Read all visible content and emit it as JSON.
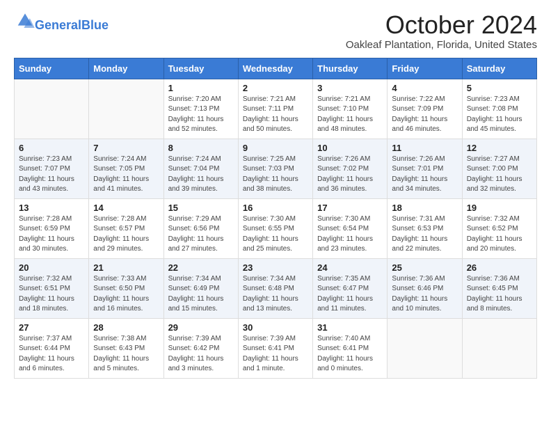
{
  "header": {
    "logo_general": "General",
    "logo_blue": "Blue",
    "month_title": "October 2024",
    "location": "Oakleaf Plantation, Florida, United States"
  },
  "days_of_week": [
    "Sunday",
    "Monday",
    "Tuesday",
    "Wednesday",
    "Thursday",
    "Friday",
    "Saturday"
  ],
  "weeks": [
    [
      {
        "day": "",
        "sunrise": "",
        "sunset": "",
        "daylight": ""
      },
      {
        "day": "",
        "sunrise": "",
        "sunset": "",
        "daylight": ""
      },
      {
        "day": "1",
        "sunrise": "Sunrise: 7:20 AM",
        "sunset": "Sunset: 7:13 PM",
        "daylight": "Daylight: 11 hours and 52 minutes."
      },
      {
        "day": "2",
        "sunrise": "Sunrise: 7:21 AM",
        "sunset": "Sunset: 7:11 PM",
        "daylight": "Daylight: 11 hours and 50 minutes."
      },
      {
        "day": "3",
        "sunrise": "Sunrise: 7:21 AM",
        "sunset": "Sunset: 7:10 PM",
        "daylight": "Daylight: 11 hours and 48 minutes."
      },
      {
        "day": "4",
        "sunrise": "Sunrise: 7:22 AM",
        "sunset": "Sunset: 7:09 PM",
        "daylight": "Daylight: 11 hours and 46 minutes."
      },
      {
        "day": "5",
        "sunrise": "Sunrise: 7:23 AM",
        "sunset": "Sunset: 7:08 PM",
        "daylight": "Daylight: 11 hours and 45 minutes."
      }
    ],
    [
      {
        "day": "6",
        "sunrise": "Sunrise: 7:23 AM",
        "sunset": "Sunset: 7:07 PM",
        "daylight": "Daylight: 11 hours and 43 minutes."
      },
      {
        "day": "7",
        "sunrise": "Sunrise: 7:24 AM",
        "sunset": "Sunset: 7:05 PM",
        "daylight": "Daylight: 11 hours and 41 minutes."
      },
      {
        "day": "8",
        "sunrise": "Sunrise: 7:24 AM",
        "sunset": "Sunset: 7:04 PM",
        "daylight": "Daylight: 11 hours and 39 minutes."
      },
      {
        "day": "9",
        "sunrise": "Sunrise: 7:25 AM",
        "sunset": "Sunset: 7:03 PM",
        "daylight": "Daylight: 11 hours and 38 minutes."
      },
      {
        "day": "10",
        "sunrise": "Sunrise: 7:26 AM",
        "sunset": "Sunset: 7:02 PM",
        "daylight": "Daylight: 11 hours and 36 minutes."
      },
      {
        "day": "11",
        "sunrise": "Sunrise: 7:26 AM",
        "sunset": "Sunset: 7:01 PM",
        "daylight": "Daylight: 11 hours and 34 minutes."
      },
      {
        "day": "12",
        "sunrise": "Sunrise: 7:27 AM",
        "sunset": "Sunset: 7:00 PM",
        "daylight": "Daylight: 11 hours and 32 minutes."
      }
    ],
    [
      {
        "day": "13",
        "sunrise": "Sunrise: 7:28 AM",
        "sunset": "Sunset: 6:59 PM",
        "daylight": "Daylight: 11 hours and 30 minutes."
      },
      {
        "day": "14",
        "sunrise": "Sunrise: 7:28 AM",
        "sunset": "Sunset: 6:57 PM",
        "daylight": "Daylight: 11 hours and 29 minutes."
      },
      {
        "day": "15",
        "sunrise": "Sunrise: 7:29 AM",
        "sunset": "Sunset: 6:56 PM",
        "daylight": "Daylight: 11 hours and 27 minutes."
      },
      {
        "day": "16",
        "sunrise": "Sunrise: 7:30 AM",
        "sunset": "Sunset: 6:55 PM",
        "daylight": "Daylight: 11 hours and 25 minutes."
      },
      {
        "day": "17",
        "sunrise": "Sunrise: 7:30 AM",
        "sunset": "Sunset: 6:54 PM",
        "daylight": "Daylight: 11 hours and 23 minutes."
      },
      {
        "day": "18",
        "sunrise": "Sunrise: 7:31 AM",
        "sunset": "Sunset: 6:53 PM",
        "daylight": "Daylight: 11 hours and 22 minutes."
      },
      {
        "day": "19",
        "sunrise": "Sunrise: 7:32 AM",
        "sunset": "Sunset: 6:52 PM",
        "daylight": "Daylight: 11 hours and 20 minutes."
      }
    ],
    [
      {
        "day": "20",
        "sunrise": "Sunrise: 7:32 AM",
        "sunset": "Sunset: 6:51 PM",
        "daylight": "Daylight: 11 hours and 18 minutes."
      },
      {
        "day": "21",
        "sunrise": "Sunrise: 7:33 AM",
        "sunset": "Sunset: 6:50 PM",
        "daylight": "Daylight: 11 hours and 16 minutes."
      },
      {
        "day": "22",
        "sunrise": "Sunrise: 7:34 AM",
        "sunset": "Sunset: 6:49 PM",
        "daylight": "Daylight: 11 hours and 15 minutes."
      },
      {
        "day": "23",
        "sunrise": "Sunrise: 7:34 AM",
        "sunset": "Sunset: 6:48 PM",
        "daylight": "Daylight: 11 hours and 13 minutes."
      },
      {
        "day": "24",
        "sunrise": "Sunrise: 7:35 AM",
        "sunset": "Sunset: 6:47 PM",
        "daylight": "Daylight: 11 hours and 11 minutes."
      },
      {
        "day": "25",
        "sunrise": "Sunrise: 7:36 AM",
        "sunset": "Sunset: 6:46 PM",
        "daylight": "Daylight: 11 hours and 10 minutes."
      },
      {
        "day": "26",
        "sunrise": "Sunrise: 7:36 AM",
        "sunset": "Sunset: 6:45 PM",
        "daylight": "Daylight: 11 hours and 8 minutes."
      }
    ],
    [
      {
        "day": "27",
        "sunrise": "Sunrise: 7:37 AM",
        "sunset": "Sunset: 6:44 PM",
        "daylight": "Daylight: 11 hours and 6 minutes."
      },
      {
        "day": "28",
        "sunrise": "Sunrise: 7:38 AM",
        "sunset": "Sunset: 6:43 PM",
        "daylight": "Daylight: 11 hours and 5 minutes."
      },
      {
        "day": "29",
        "sunrise": "Sunrise: 7:39 AM",
        "sunset": "Sunset: 6:42 PM",
        "daylight": "Daylight: 11 hours and 3 minutes."
      },
      {
        "day": "30",
        "sunrise": "Sunrise: 7:39 AM",
        "sunset": "Sunset: 6:41 PM",
        "daylight": "Daylight: 11 hours and 1 minute."
      },
      {
        "day": "31",
        "sunrise": "Sunrise: 7:40 AM",
        "sunset": "Sunset: 6:41 PM",
        "daylight": "Daylight: 11 hours and 0 minutes."
      },
      {
        "day": "",
        "sunrise": "",
        "sunset": "",
        "daylight": ""
      },
      {
        "day": "",
        "sunrise": "",
        "sunset": "",
        "daylight": ""
      }
    ]
  ]
}
